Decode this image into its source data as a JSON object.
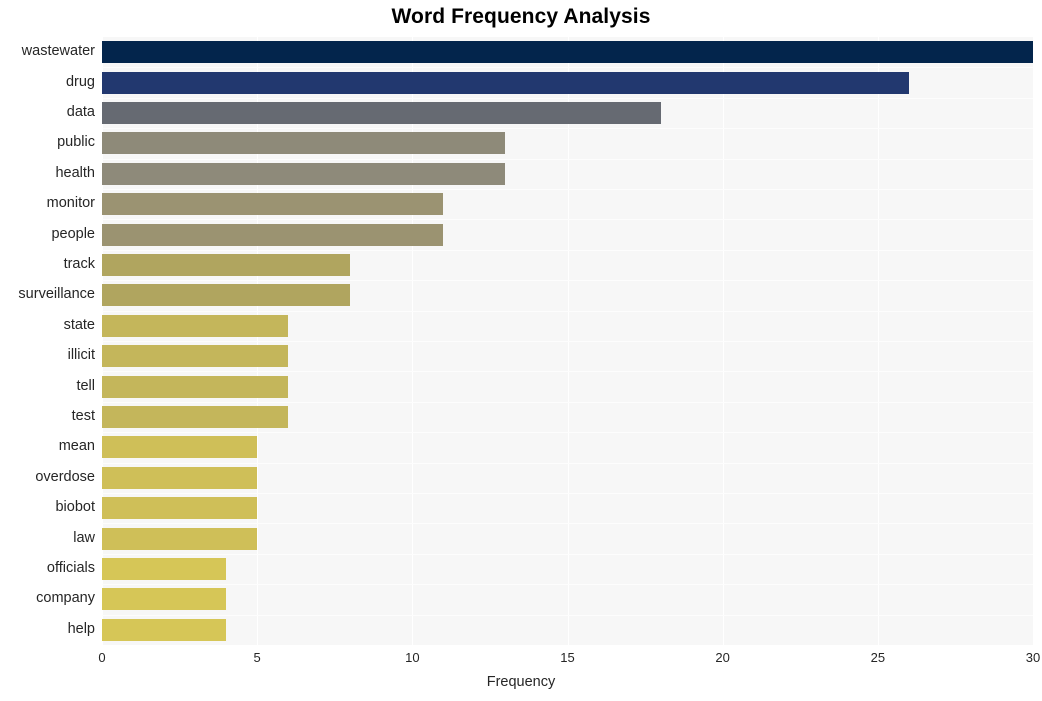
{
  "chart_data": {
    "type": "bar",
    "orientation": "horizontal",
    "title": "Word Frequency Analysis",
    "xlabel": "Frequency",
    "ylabel": "",
    "categories": [
      "wastewater",
      "drug",
      "data",
      "public",
      "health",
      "monitor",
      "people",
      "track",
      "surveillance",
      "state",
      "illicit",
      "tell",
      "test",
      "mean",
      "overdose",
      "biobot",
      "law",
      "officials",
      "company",
      "help"
    ],
    "values": [
      30,
      26,
      18,
      13,
      13,
      11,
      11,
      8,
      8,
      6,
      6,
      6,
      6,
      5,
      5,
      5,
      5,
      4,
      4,
      4
    ],
    "bar_colors": [
      "#03254c",
      "#22386f",
      "#666a72",
      "#8e8a79",
      "#8e8a7a",
      "#9b9372",
      "#9b9371",
      "#b0a55f",
      "#b0a55f",
      "#c4b65b",
      "#c4b65b",
      "#c4b65b",
      "#c4b65b",
      "#cfbf58",
      "#cfbf58",
      "#cfbf58",
      "#cfbf58",
      "#d6c657",
      "#d6c657",
      "#d6c657"
    ],
    "xticks": [
      0,
      5,
      10,
      15,
      20,
      25,
      30
    ],
    "xlim": [
      0,
      30
    ],
    "grid": true,
    "grid_axis": "x",
    "legend": false,
    "plot_background": "#f7f7f7",
    "figure_background": "#ffffff"
  }
}
